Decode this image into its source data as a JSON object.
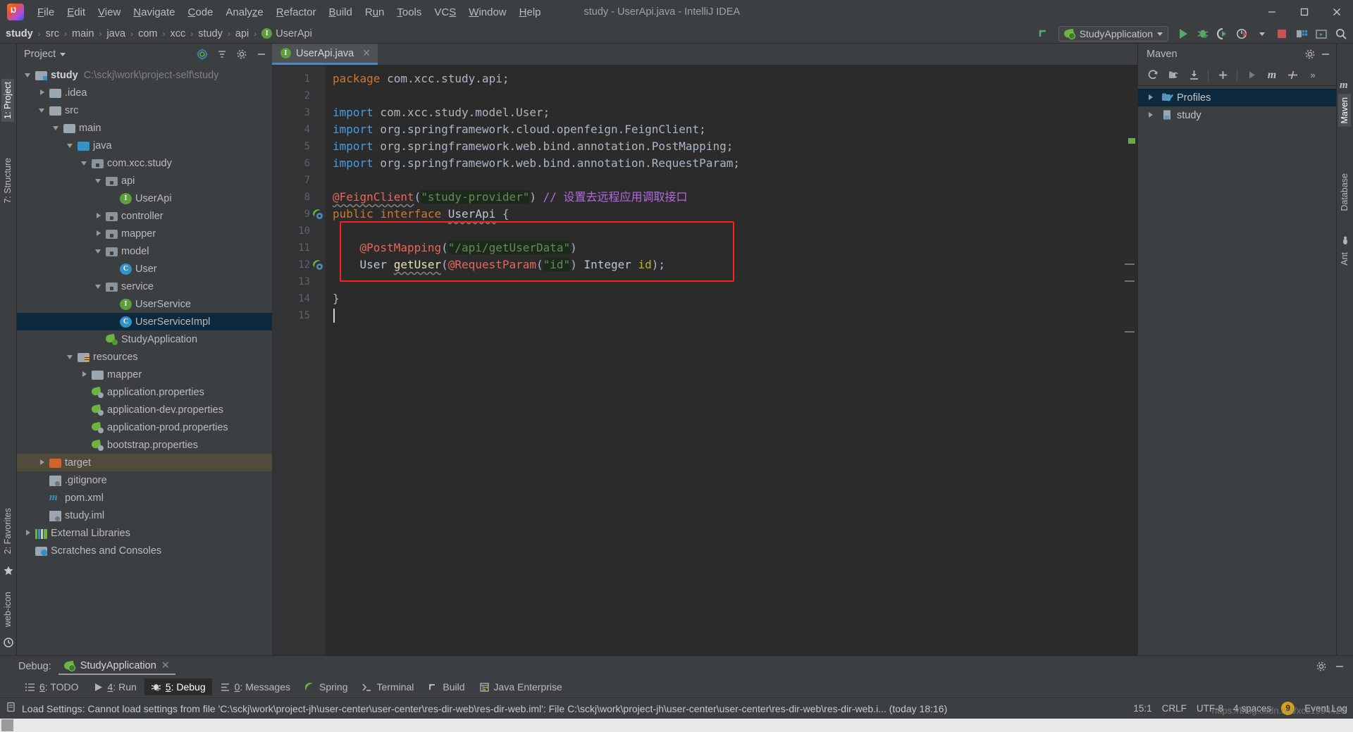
{
  "window": {
    "title": "study - UserApi.java - IntelliJ IDEA",
    "logo_text": "IJ",
    "minimize": "—",
    "maximize": "❐",
    "close": "✕"
  },
  "menubar": {
    "items": [
      {
        "label": "File"
      },
      {
        "label": "Edit"
      },
      {
        "label": "View"
      },
      {
        "label": "Navigate"
      },
      {
        "label": "Code"
      },
      {
        "label": "Analyze"
      },
      {
        "label": "Refactor"
      },
      {
        "label": "Build"
      },
      {
        "label": "Run"
      },
      {
        "label": "Tools"
      },
      {
        "label": "VCS"
      },
      {
        "label": "Window"
      },
      {
        "label": "Help"
      }
    ]
  },
  "breadcrumb": {
    "items": [
      "study",
      "src",
      "main",
      "java",
      "com",
      "xcc",
      "study",
      "api"
    ],
    "separator": "›",
    "final_icon": "interface-icon",
    "final_icon_letter": "I",
    "final_label": "UserApi"
  },
  "toolbar": {
    "run_config": "StudyApplication",
    "icons": [
      "updating-project-icon",
      "run-icon",
      "debug-icon",
      "run-with-coverage-icon",
      "profiler-icon",
      "stop-icon",
      "project-structure-icon",
      "terminal-icon",
      "search-icon"
    ]
  },
  "left_rail": {
    "tabs": [
      "1: Project",
      "7: Structure",
      "2: Favorites"
    ],
    "bottom_icons": [
      "web-icon",
      "todo-icon"
    ]
  },
  "right_rail": {
    "tabs": [
      "Maven",
      "Database",
      "Ant"
    ]
  },
  "project_panel": {
    "title": "Project",
    "title_caret": "▾",
    "header_icons": [
      "locate-icon",
      "collapse-all-icon",
      "settings-icon",
      "hide-icon"
    ],
    "tree": [
      {
        "indent": 0,
        "arrow": "down",
        "icon": "project-folder-icon",
        "label": "study",
        "bold": true,
        "sub": "C:\\sckj\\work\\project-self\\study"
      },
      {
        "indent": 1,
        "arrow": "right",
        "icon": "folder-icon",
        "label": ".idea"
      },
      {
        "indent": 1,
        "arrow": "down",
        "icon": "folder-icon",
        "label": "src"
      },
      {
        "indent": 2,
        "arrow": "down",
        "icon": "folder-icon",
        "label": "main"
      },
      {
        "indent": 3,
        "arrow": "down",
        "icon": "source-folder-icon",
        "label": "java"
      },
      {
        "indent": 4,
        "arrow": "down",
        "icon": "package-icon",
        "label": "com.xcc.study"
      },
      {
        "indent": 5,
        "arrow": "down",
        "icon": "package-icon",
        "label": "api"
      },
      {
        "indent": 6,
        "arrow": "none",
        "icon": "interface-icon",
        "label": "UserApi"
      },
      {
        "indent": 5,
        "arrow": "right",
        "icon": "package-icon",
        "label": "controller"
      },
      {
        "indent": 5,
        "arrow": "right",
        "icon": "package-icon",
        "label": "mapper"
      },
      {
        "indent": 5,
        "arrow": "down",
        "icon": "package-icon",
        "label": "model"
      },
      {
        "indent": 6,
        "arrow": "none",
        "icon": "class-icon",
        "label": "User"
      },
      {
        "indent": 5,
        "arrow": "down",
        "icon": "package-icon",
        "label": "service"
      },
      {
        "indent": 6,
        "arrow": "none",
        "icon": "interface-icon",
        "label": "UserService"
      },
      {
        "indent": 6,
        "arrow": "none",
        "icon": "class-icon",
        "label": "UserServiceImpl",
        "selected": true
      },
      {
        "indent": 5,
        "arrow": "none",
        "icon": "spring-app-icon",
        "label": "StudyApplication"
      },
      {
        "indent": 3,
        "arrow": "down",
        "icon": "resources-folder-icon",
        "label": "resources"
      },
      {
        "indent": 4,
        "arrow": "right",
        "icon": "folder-icon",
        "label": "mapper"
      },
      {
        "indent": 4,
        "arrow": "none",
        "icon": "spring-properties-icon",
        "label": "application.properties"
      },
      {
        "indent": 4,
        "arrow": "none",
        "icon": "spring-properties-icon",
        "label": "application-dev.properties"
      },
      {
        "indent": 4,
        "arrow": "none",
        "icon": "spring-properties-icon",
        "label": "application-prod.properties"
      },
      {
        "indent": 4,
        "arrow": "none",
        "icon": "spring-properties-icon",
        "label": "bootstrap.properties"
      },
      {
        "indent": 1,
        "arrow": "right",
        "icon": "target-folder-icon",
        "label": "target",
        "excluded": true
      },
      {
        "indent": 1,
        "arrow": "none",
        "icon": "gitignore-file-icon",
        "label": ".gitignore"
      },
      {
        "indent": 1,
        "arrow": "none",
        "icon": "maven-file-icon",
        "label": "pom.xml"
      },
      {
        "indent": 1,
        "arrow": "none",
        "icon": "iml-file-icon",
        "label": "study.iml"
      },
      {
        "indent": 0,
        "arrow": "right",
        "icon": "external-libraries-icon",
        "label": "External Libraries"
      },
      {
        "indent": 0,
        "arrow": "none",
        "icon": "scratches-icon",
        "label": "Scratches and Consoles"
      }
    ]
  },
  "editor": {
    "tab": {
      "label": "UserApi.java",
      "icon": "interface-icon",
      "icon_letter": "I",
      "close": "✕"
    },
    "caret_line": 15,
    "caret_position": "15:1",
    "red_highlight_lines": [
      10,
      11,
      12,
      13
    ],
    "lines": [
      {
        "n": 1,
        "fold": "none",
        "gutter_icon": "none",
        "tokens": [
          {
            "t": "package",
            "c": "kw"
          },
          {
            "t": " com.xcc.study.api;",
            "c": "pln"
          }
        ]
      },
      {
        "n": 2,
        "fold": "none",
        "gutter_icon": "none",
        "tokens": []
      },
      {
        "n": 3,
        "fold": "start",
        "gutter_icon": "none",
        "tokens": [
          {
            "t": "import",
            "c": "kw2"
          },
          {
            "t": " com.xcc.study.model.User;",
            "c": "pln"
          }
        ]
      },
      {
        "n": 4,
        "fold": "none",
        "gutter_icon": "none",
        "tokens": [
          {
            "t": "import",
            "c": "kw2"
          },
          {
            "t": " org.springframework.cloud.openfeign.FeignClient;",
            "c": "pln"
          }
        ]
      },
      {
        "n": 5,
        "fold": "none",
        "gutter_icon": "none",
        "tokens": [
          {
            "t": "import",
            "c": "kw2"
          },
          {
            "t": " org.springframework.web.bind.annotation.PostMapping;",
            "c": "pln"
          }
        ]
      },
      {
        "n": 6,
        "fold": "end",
        "gutter_icon": "none",
        "tokens": [
          {
            "t": "import",
            "c": "kw2"
          },
          {
            "t": " org.springframework.web.bind.annotation.RequestParam;",
            "c": "pln"
          }
        ]
      },
      {
        "n": 7,
        "fold": "none",
        "gutter_icon": "none",
        "tokens": []
      },
      {
        "n": 8,
        "fold": "none",
        "gutter_icon": "none",
        "tokens": [
          {
            "t": "@FeignClient",
            "c": "annoR wavy"
          },
          {
            "t": "(",
            "c": "pln"
          },
          {
            "t": "\"study-provider\"",
            "c": "str"
          },
          {
            "t": ")",
            "c": "pln"
          },
          {
            "t": " // 设置去远程应用调取接口",
            "c": "cmt"
          }
        ]
      },
      {
        "n": 9,
        "fold": "none",
        "gutter_icon": "spring-bean-icon",
        "tokens": [
          {
            "t": "public",
            "c": "kw"
          },
          {
            "t": " ",
            "c": "pln"
          },
          {
            "t": "interface",
            "c": "kw"
          },
          {
            "t": " ",
            "c": "pln"
          },
          {
            "t": "UserApi",
            "c": "cls wavy"
          },
          {
            "t": " {",
            "c": "pln"
          }
        ]
      },
      {
        "n": 10,
        "fold": "none",
        "gutter_icon": "none",
        "tokens": []
      },
      {
        "n": 11,
        "fold": "none",
        "gutter_icon": "none",
        "tokens": [
          {
            "t": "    ",
            "c": "pln"
          },
          {
            "t": "@PostMapping",
            "c": "annoR"
          },
          {
            "t": "(",
            "c": "pln"
          },
          {
            "t": "\"/api/getUserData\"",
            "c": "str"
          },
          {
            "t": ")",
            "c": "pln"
          }
        ]
      },
      {
        "n": 12,
        "fold": "none",
        "gutter_icon": "spring-bean-icon",
        "tokens": [
          {
            "t": "    ",
            "c": "pln"
          },
          {
            "t": "User",
            "c": "cls"
          },
          {
            "t": " ",
            "c": "pln"
          },
          {
            "t": "getUser",
            "c": "mth wavy"
          },
          {
            "t": "(",
            "c": "pln"
          },
          {
            "t": "@RequestParam",
            "c": "annoR"
          },
          {
            "t": "(",
            "c": "pln"
          },
          {
            "t": "\"id\"",
            "c": "str"
          },
          {
            "t": ") ",
            "c": "pln"
          },
          {
            "t": "Integer",
            "c": "cls"
          },
          {
            "t": " ",
            "c": "pln"
          },
          {
            "t": "id",
            "c": "anno"
          },
          {
            "t": ");",
            "c": "pln"
          }
        ]
      },
      {
        "n": 13,
        "fold": "none",
        "gutter_icon": "none",
        "tokens": []
      },
      {
        "n": 14,
        "fold": "none",
        "gutter_icon": "none",
        "tokens": [
          {
            "t": "}",
            "c": "pln"
          }
        ]
      },
      {
        "n": 15,
        "fold": "none",
        "gutter_icon": "none",
        "tokens": []
      }
    ]
  },
  "maven_panel": {
    "title": "Maven",
    "header_icons": [
      "settings-icon",
      "hide-icon"
    ],
    "toolbar_icons": [
      "reimport-icon",
      "generate-sources-icon",
      "download-sources-icon",
      "add-maven-project-icon",
      "run-icon",
      "execute-goal-icon",
      "toggle-offline-icon",
      "expand-icon"
    ],
    "tree": [
      {
        "arrow": "right",
        "icon": "profiles-icon",
        "label": "Profiles",
        "selected": true
      },
      {
        "arrow": "right",
        "icon": "maven-project-icon",
        "label": "study"
      }
    ]
  },
  "debug_panel": {
    "label": "Debug:",
    "session": "StudyApplication",
    "session_icon": "spring-app-icon",
    "close": "✕",
    "right_icons": [
      "settings-icon",
      "hide-icon"
    ]
  },
  "status_tabs": [
    {
      "num": "6",
      "label": "TODO",
      "icon": "todo-icon",
      "selected": false
    },
    {
      "num": "4",
      "label": "Run",
      "icon": "run-icon",
      "selected": false
    },
    {
      "num": "5",
      "label": "Debug",
      "icon": "debug-icon",
      "selected": true
    },
    {
      "num": "0",
      "label": "Messages",
      "icon": "messages-icon",
      "selected": false
    },
    {
      "num": "",
      "label": "Spring",
      "icon": "spring-icon",
      "selected": false
    },
    {
      "num": "",
      "label": "Terminal",
      "icon": "terminal-icon",
      "selected": false
    },
    {
      "num": "",
      "label": "Build",
      "icon": "build-icon",
      "selected": false
    },
    {
      "num": "",
      "label": "Java Enterprise",
      "icon": "java-enterprise-icon",
      "selected": false
    }
  ],
  "status_bar": {
    "message_icon": "notification-icon",
    "message": "Load Settings: Cannot load settings from file 'C:\\sckj\\work\\project-jh\\user-center\\user-center\\res-dir-web\\res-dir-web.iml': File C:\\sckj\\work\\project-jh\\user-center\\user-center\\res-dir-web\\res-dir-web.i... (today 18:16)",
    "caret_position": "15:1",
    "line_separator": "CRLF",
    "encoding": "UTF-8",
    "indent": "4 spaces",
    "event_log": "Event Log",
    "event_count": "9",
    "watermark": "https://blog.csdn.net/xcc1994428"
  },
  "colors": {
    "accent_blue": "#4a88c7",
    "selection": "#0d293e",
    "highlight_red": "#ff2020",
    "editor_bg": "#2b2b2b",
    "panel_bg": "#3c3f41",
    "spring_green": "#6db33f"
  }
}
